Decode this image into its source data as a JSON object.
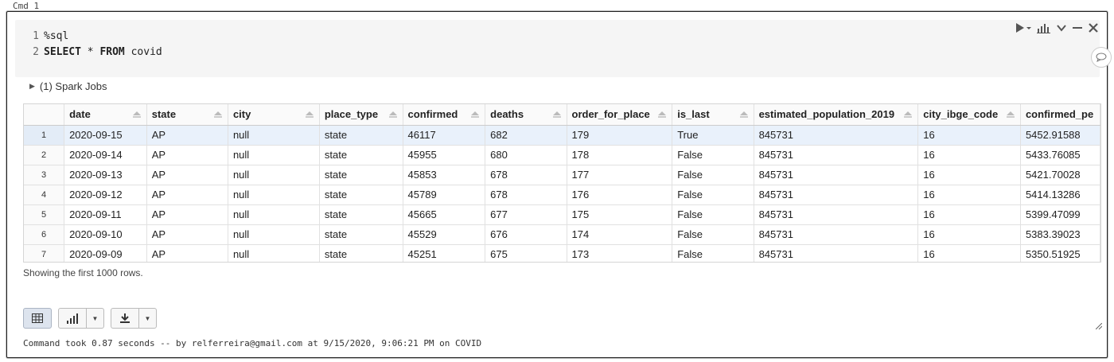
{
  "cmd_label": "Cmd 1",
  "code": [
    {
      "num": "1",
      "parts": [
        {
          "text": "%sql",
          "kw": false
        }
      ]
    },
    {
      "num": "2",
      "parts": [
        {
          "text": "SELECT",
          "kw": true
        },
        {
          "text": " * ",
          "kw": false
        },
        {
          "text": "FROM",
          "kw": true
        },
        {
          "text": " covid",
          "kw": false
        }
      ]
    }
  ],
  "toolbar": {
    "icons": [
      "run-icon",
      "chart-icon",
      "collapse-icon",
      "minimize-icon",
      "close-icon"
    ]
  },
  "spark_jobs": "(1) Spark Jobs",
  "table": {
    "columns": [
      "date",
      "state",
      "city",
      "place_type",
      "confirmed",
      "deaths",
      "order_for_place",
      "is_last",
      "estimated_population_2019",
      "city_ibge_code",
      "confirmed_pe"
    ],
    "rows": [
      [
        "1",
        "2020-09-15",
        "AP",
        "null",
        "state",
        "46117",
        "682",
        "179",
        "True",
        "845731",
        "16",
        "5452.91588"
      ],
      [
        "2",
        "2020-09-14",
        "AP",
        "null",
        "state",
        "45955",
        "680",
        "178",
        "False",
        "845731",
        "16",
        "5433.76085"
      ],
      [
        "3",
        "2020-09-13",
        "AP",
        "null",
        "state",
        "45853",
        "678",
        "177",
        "False",
        "845731",
        "16",
        "5421.70028"
      ],
      [
        "4",
        "2020-09-12",
        "AP",
        "null",
        "state",
        "45789",
        "678",
        "176",
        "False",
        "845731",
        "16",
        "5414.13286"
      ],
      [
        "5",
        "2020-09-11",
        "AP",
        "null",
        "state",
        "45665",
        "677",
        "175",
        "False",
        "845731",
        "16",
        "5399.47099"
      ],
      [
        "6",
        "2020-09-10",
        "AP",
        "null",
        "state",
        "45529",
        "676",
        "174",
        "False",
        "845731",
        "16",
        "5383.39023"
      ],
      [
        "7",
        "2020-09-09",
        "AP",
        "null",
        "state",
        "45251",
        "675",
        "173",
        "False",
        "845731",
        "16",
        "5350.51925"
      ]
    ]
  },
  "showing": "Showing the first 1000 rows.",
  "status": "Command took 0.87 seconds -- by relferreira@gmail.com at 9/15/2020, 9:06:21 PM on COVID"
}
